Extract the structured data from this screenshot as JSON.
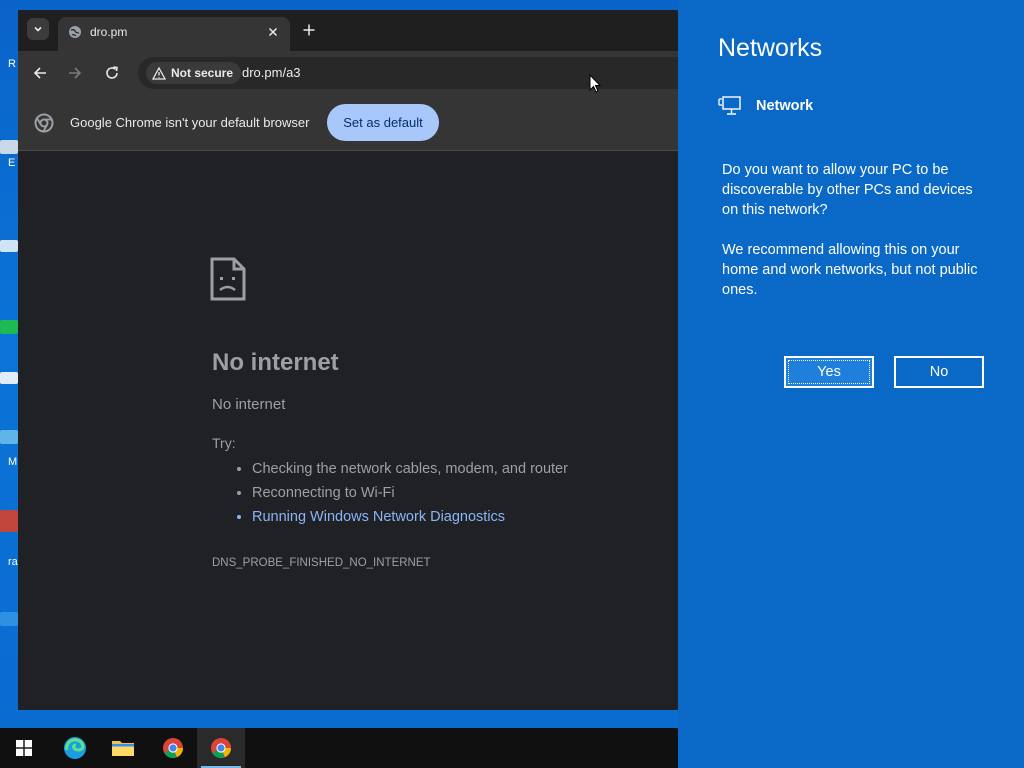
{
  "desktop": {
    "fragments": [
      "R",
      "E",
      "M",
      "ra"
    ],
    "colors": {
      "wallpaper": "#0a6ad0"
    }
  },
  "browser": {
    "tab": {
      "title": "dro.pm",
      "favicon": "globe-icon"
    },
    "toolbar": {
      "security_label": "Not secure",
      "url": "dro.pm/a3"
    },
    "infobar": {
      "message": "Google Chrome isn't your default browser",
      "button_label": "Set as default"
    },
    "error_page": {
      "title": "No internet",
      "subtitle": "No internet",
      "try_label": "Try:",
      "suggestions": [
        "Checking the network cables, modem, and router",
        "Reconnecting to Wi-Fi",
        "Running Windows Network Diagnostics"
      ],
      "error_code": "DNS_PROBE_FINISHED_NO_INTERNET"
    },
    "colors": {
      "background": "#202124",
      "toolbar": "#353535",
      "link": "#8ab4f8",
      "button": "#a8c7fa"
    }
  },
  "networks_flyout": {
    "title": "Networks",
    "network_name": "Network",
    "question": "Do you want to allow your PC to be discoverable by other PCs and devices on this network?",
    "recommendation": "We recommend allowing this on your home and work networks, but not public ones.",
    "yes_label": "Yes",
    "no_label": "No",
    "colors": {
      "background": "#0a69c7"
    }
  },
  "taskbar": {
    "items": [
      "start-icon",
      "edge-icon",
      "file-explorer-icon",
      "chrome-icon",
      "chrome-icon"
    ]
  }
}
